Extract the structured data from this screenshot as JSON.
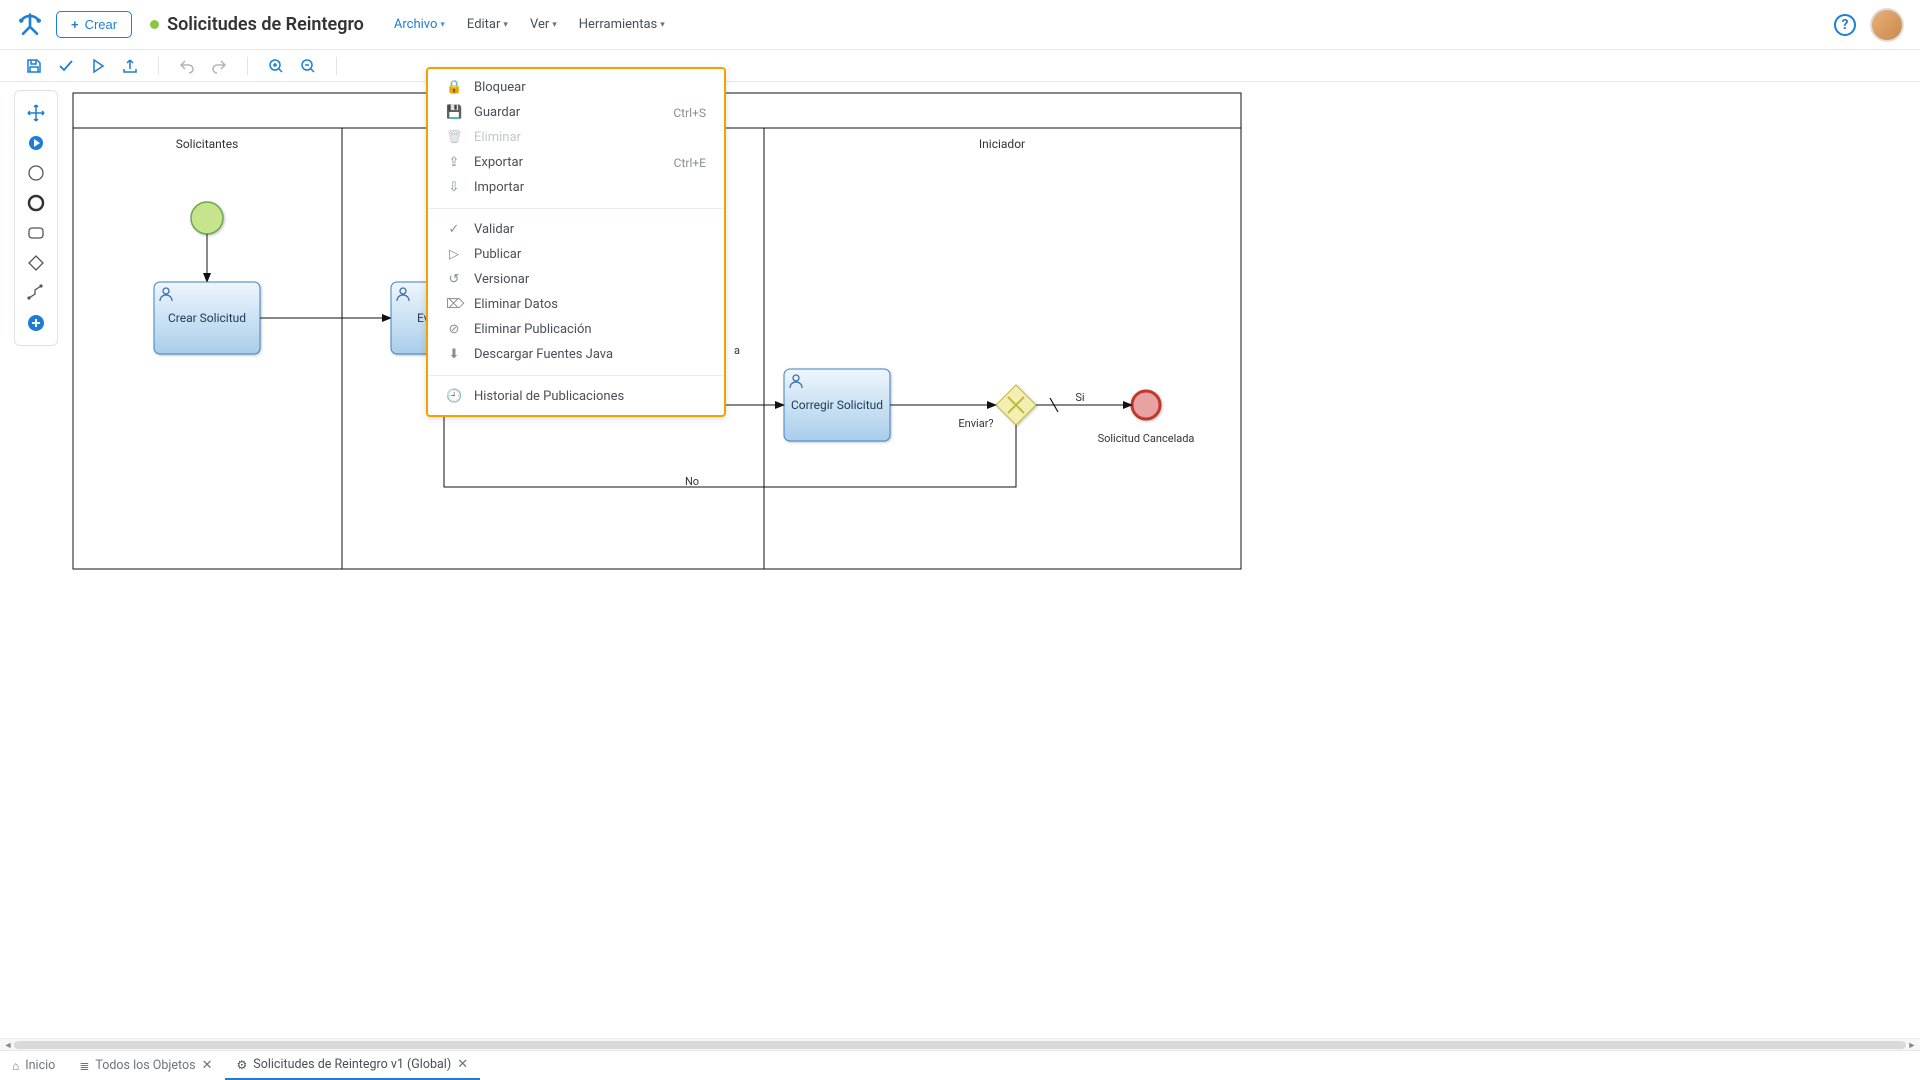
{
  "header": {
    "create_label": "Crear",
    "title": "Solicitudes de Reintegro",
    "menus": [
      {
        "key": "archivo",
        "label": "Archivo",
        "open": true
      },
      {
        "key": "editar",
        "label": "Editar"
      },
      {
        "key": "ver",
        "label": "Ver"
      },
      {
        "key": "herramientas",
        "label": "Herramientas"
      }
    ],
    "help_symbol": "?"
  },
  "dropdown": {
    "menu_key": "archivo",
    "groups": [
      [
        {
          "icon": "lock",
          "label": "Bloquear"
        },
        {
          "icon": "save",
          "label": "Guardar",
          "shortcut": "Ctrl+S"
        },
        {
          "icon": "trash",
          "label": "Eliminar",
          "disabled": true
        },
        {
          "icon": "export",
          "label": "Exportar",
          "shortcut": "Ctrl+E"
        },
        {
          "icon": "import",
          "label": "Importar"
        }
      ],
      [
        {
          "icon": "check",
          "label": "Validar"
        },
        {
          "icon": "play",
          "label": "Publicar"
        },
        {
          "icon": "history",
          "label": "Versionar"
        },
        {
          "icon": "wipe",
          "label": "Eliminar Datos"
        },
        {
          "icon": "remove",
          "label": "Eliminar Publicación"
        },
        {
          "icon": "download",
          "label": "Descargar Fuentes Java"
        }
      ],
      [
        {
          "icon": "clock",
          "label": "Historial de Publicaciones"
        }
      ]
    ]
  },
  "toolbar_icons": [
    "save",
    "check",
    "play",
    "export",
    "undo",
    "redo",
    "zoom-in",
    "zoom-out"
  ],
  "diagram": {
    "pool_title": "",
    "lanes": [
      "Solicitantes",
      "",
      "Iniciador"
    ],
    "tasks": {
      "crear": "Crear Solicitud",
      "evaluar_prefix": "Evalua",
      "corregir": "Corregir Solicitud"
    },
    "gateway_label": "Enviar?",
    "end_label": "Solicitud Cancelada",
    "edge_right_fragment": "a",
    "edge_no1": "No",
    "edge_no2": "No",
    "edge_si": "Si"
  },
  "bottom_tabs": [
    {
      "icon": "home",
      "label": "Inicio",
      "closable": false
    },
    {
      "icon": "list",
      "label": "Todos los Objetos",
      "closable": true
    },
    {
      "icon": "flow",
      "label": "Solicitudes de Reintegro v1 (Global)",
      "closable": true,
      "active": true
    }
  ]
}
